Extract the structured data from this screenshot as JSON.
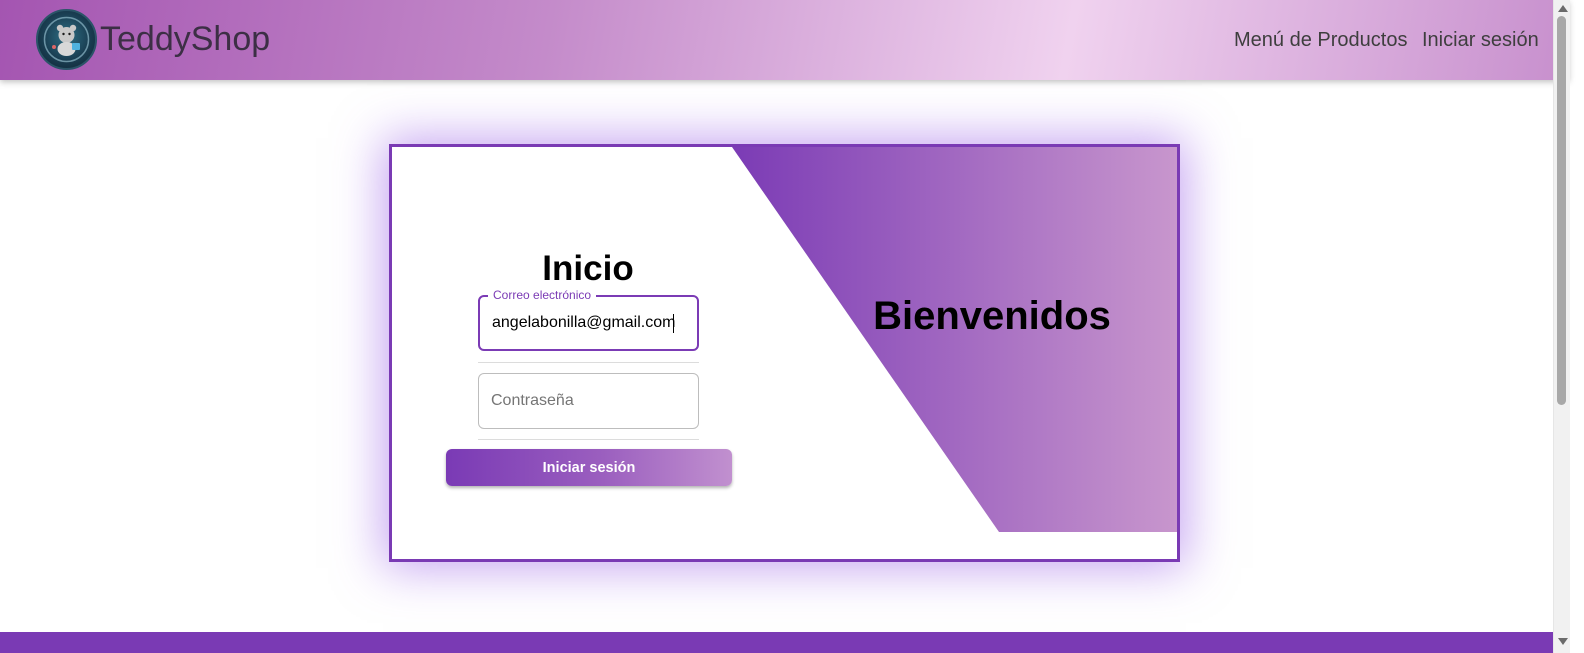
{
  "navbar": {
    "brand": "TeddyShop",
    "links": [
      {
        "label": "Menú de Productos"
      },
      {
        "label": "Iniciar sesión"
      }
    ]
  },
  "login": {
    "title": "Inicio",
    "email_label": "Correo electrónico",
    "email_value": "angelabonilla@gmail.com",
    "password_placeholder": "Contraseña",
    "submit_label": "Iniciar sesión"
  },
  "welcome": {
    "title": "Bienvenidos"
  },
  "colors": {
    "accent": "#7a3ab4",
    "gradient_end": "#c896cd"
  }
}
